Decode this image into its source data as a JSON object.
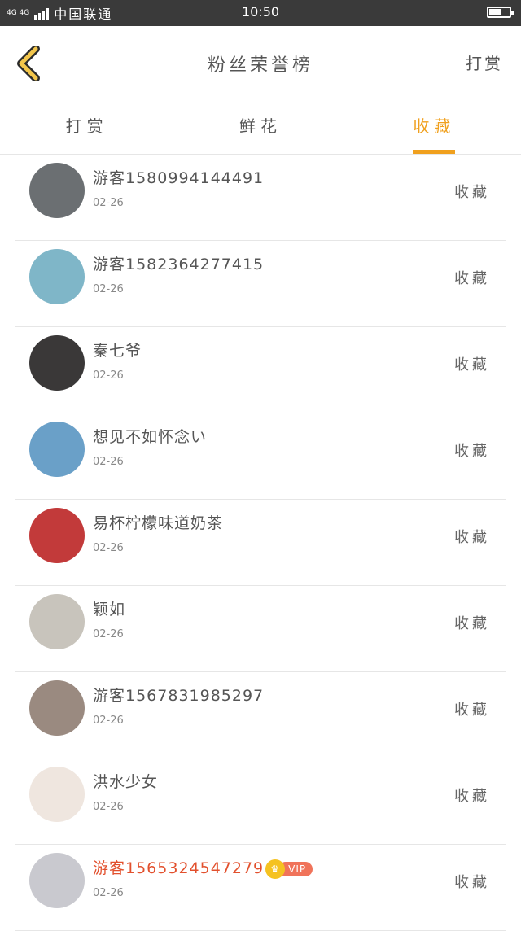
{
  "status_bar": {
    "network": "4G 4G",
    "carrier": "中国联通",
    "time": "10:50",
    "battery_level": 0.6
  },
  "header": {
    "title": "粉丝荣誉榜",
    "right_link": "打赏",
    "accent_color": "#f0a01e"
  },
  "tabs": [
    {
      "label": "打赏",
      "active": false
    },
    {
      "label": "鲜花",
      "active": false
    },
    {
      "label": "收藏",
      "active": true
    }
  ],
  "list": [
    {
      "name": "游客1580994144491",
      "date": "02-26",
      "action": "收藏",
      "avatar_color": "#6b6f72"
    },
    {
      "name": "游客1582364277415",
      "date": "02-26",
      "action": "收藏",
      "avatar_color": "#7fb6c8"
    },
    {
      "name": "秦七爷",
      "date": "02-26",
      "action": "收藏",
      "avatar_color": "#3a3838"
    },
    {
      "name": "想见不如怀念い",
      "date": "02-26",
      "action": "收藏",
      "avatar_color": "#6aa0c8"
    },
    {
      "name": "易杯柠檬味道奶茶",
      "date": "02-26",
      "action": "收藏",
      "avatar_color": "#c23a3a"
    },
    {
      "name": "颖如",
      "date": "02-26",
      "action": "收藏",
      "avatar_color": "#c8c4bc"
    },
    {
      "name": "游客1567831985297",
      "date": "02-26",
      "action": "收藏",
      "avatar_color": "#9a8a80"
    },
    {
      "name": "洪水少女",
      "date": "02-26",
      "action": "收藏",
      "avatar_color": "#efe6df"
    },
    {
      "name": "游客1565324547279",
      "date": "02-26",
      "action": "收藏",
      "avatar_color": "#c9c9cf",
      "vip": "VIP"
    }
  ]
}
